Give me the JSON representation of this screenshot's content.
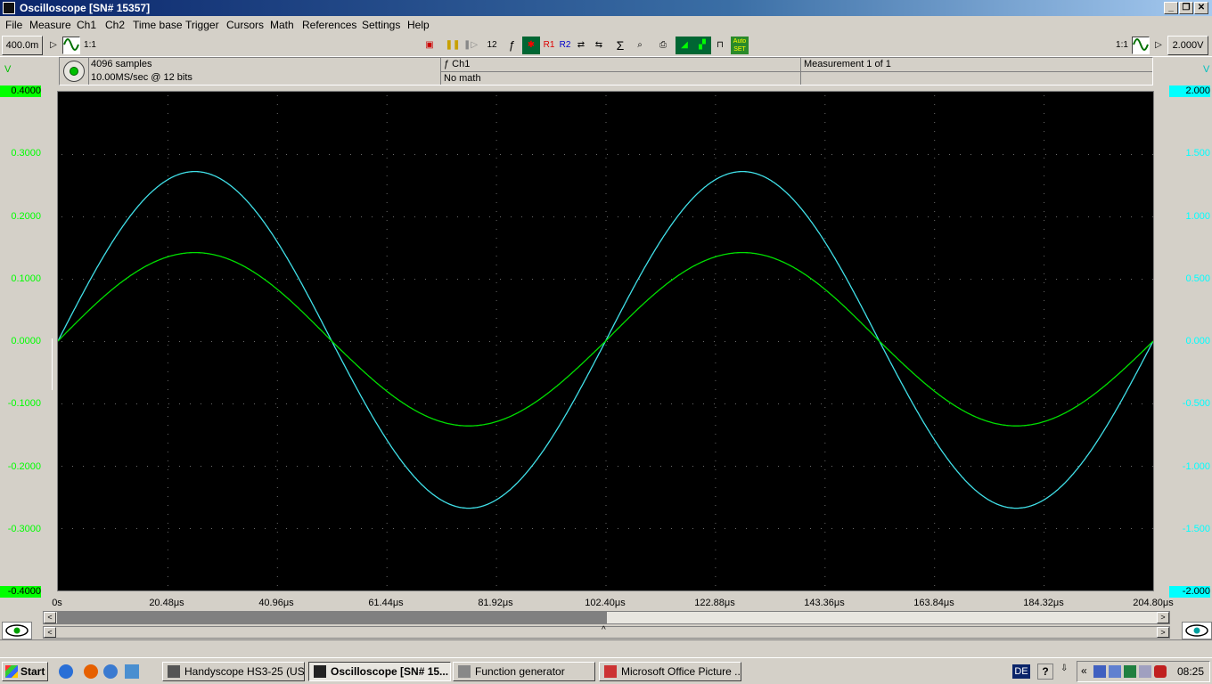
{
  "window": {
    "title": "Oscilloscope  [SN# 15357]",
    "btn_min": "_",
    "btn_restore": "❐",
    "btn_close": "✕"
  },
  "menu": [
    "File",
    "Measure",
    "Ch1",
    "Ch2",
    "Time base",
    "Trigger",
    "Cursors",
    "Math",
    "References",
    "Settings",
    "Help"
  ],
  "toolbar": {
    "left_value": "400.0m",
    "left_ratio": "1:1",
    "right_ratio": "1:1",
    "right_value": "2.000V",
    "r1": "R1",
    "r2": "R2",
    "auto_set": "Auto SET",
    "num12": "12",
    "sigma": "Σ",
    "f": "ƒ"
  },
  "info": {
    "samples": "4096 samples",
    "rate": "10.00MS/sec @ 12 bits",
    "channel": "ƒ Ch1",
    "math": "No math",
    "measurement": "Measurement 1 of 1"
  },
  "axis": {
    "left_unit": "V",
    "right_unit": "V",
    "left_ticks": [
      "0.4000",
      "0.3000",
      "0.2000",
      "0.1000",
      "0.0000",
      "-0.1000",
      "-0.2000",
      "-0.3000",
      "-0.4000"
    ],
    "right_ticks": [
      "2.000",
      "1.500",
      "1.000",
      "0.500",
      "0.000",
      "-0.500",
      "-1.000",
      "-1.500",
      "-2.000"
    ],
    "x_ticks": [
      "0s",
      "20.48μs",
      "40.96μs",
      "61.44μs",
      "81.92μs",
      "102.40μs",
      "122.88μs",
      "143.36μs",
      "163.84μs",
      "184.32μs",
      "204.80μs"
    ]
  },
  "scroll": {
    "marker": "^"
  },
  "colors": {
    "ch1": "#00e000",
    "ch2": "#40e0e8",
    "plot_bg": "#000000",
    "grid": "#6a6a6a"
  },
  "chart_data": {
    "type": "line",
    "x_unit": "μs",
    "xlim": [
      0,
      204.8
    ],
    "series": [
      {
        "name": "Ch1",
        "axis": "left",
        "ylim": [
          -0.4,
          0.4
        ],
        "amplitude": 0.142,
        "period_us": 102.4,
        "x": [
          0,
          25.6,
          51.2,
          76.8,
          102.4,
          128.0,
          153.6,
          179.2,
          204.8
        ],
        "y": [
          0.0,
          0.142,
          0.0,
          -0.136,
          0.0,
          0.142,
          0.0,
          -0.136,
          0.042
        ]
      },
      {
        "name": "Ch2",
        "axis": "right",
        "ylim": [
          -2.0,
          2.0
        ],
        "amplitude": 1.36,
        "period_us": 102.4,
        "x": [
          0,
          25.6,
          51.2,
          76.8,
          102.4,
          128.0,
          153.6,
          179.2,
          204.8
        ],
        "y": [
          0.0,
          1.36,
          0.0,
          -1.34,
          0.0,
          1.36,
          0.0,
          -1.34,
          0.36
        ]
      }
    ]
  },
  "taskbar": {
    "start": "Start",
    "tasks": [
      "Handyscope HS3-25 (US...",
      "Oscilloscope  [SN# 15...",
      "Function generator",
      "Microsoft Office Picture ..."
    ],
    "lang": "DE",
    "clock": "08:25"
  }
}
